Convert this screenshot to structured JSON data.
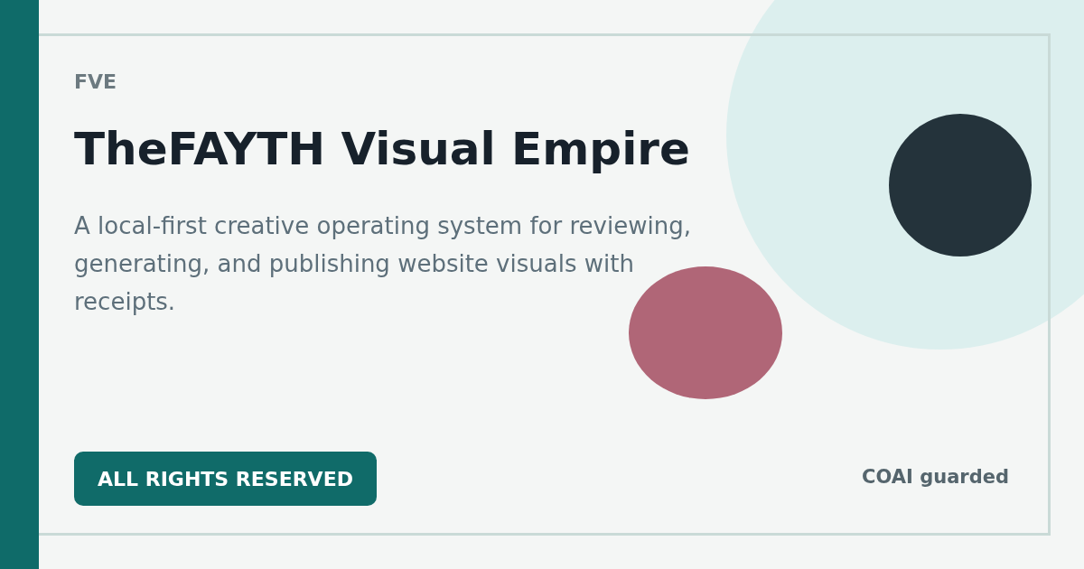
{
  "tag": "FVE",
  "title": "TheFAYTH Visual Empire",
  "description": "A local-first creative operating system for reviewing, generating, and publishing website visuals with receipts.",
  "badge": "ALL RIGHTS RESERVED",
  "footer_note": "COAI guarded"
}
